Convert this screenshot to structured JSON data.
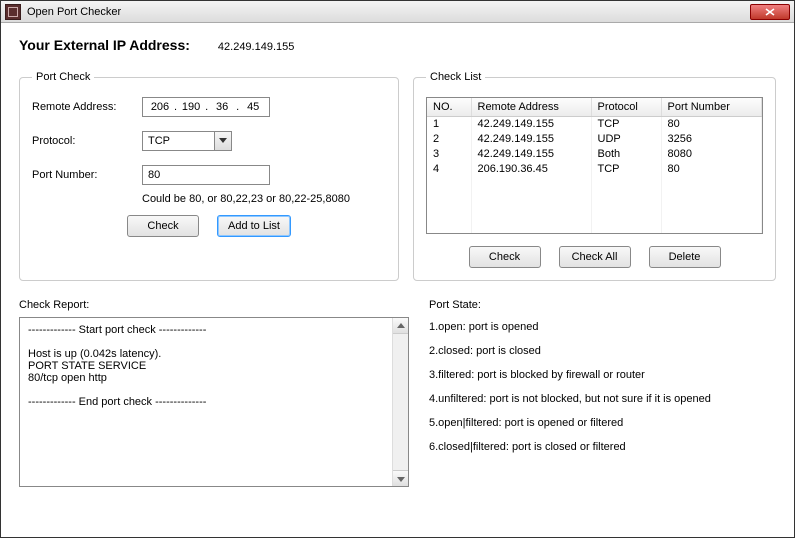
{
  "window": {
    "title": "Open Port Checker"
  },
  "header": {
    "ip_label": "Your External IP Address:",
    "ip_value": "42.249.149.155"
  },
  "portcheck": {
    "legend": "Port Check",
    "remote_addr_label": "Remote Address:",
    "remote_addr": {
      "a": "206",
      "b": "190",
      "c": "36",
      "d": "45"
    },
    "protocol_label": "Protocol:",
    "protocol_value": "TCP",
    "port_label": "Port Number:",
    "port_value": "80",
    "hint": "Could be 80, or 80,22,23 or 80,22-25,8080",
    "check_btn": "Check",
    "add_btn": "Add to List"
  },
  "checklist": {
    "legend": "Check List",
    "headers": {
      "no": "NO.",
      "addr": "Remote Address",
      "proto": "Protocol",
      "port": "Port Number"
    },
    "rows": [
      {
        "no": "1",
        "addr": "42.249.149.155",
        "proto": "TCP",
        "port": "80"
      },
      {
        "no": "2",
        "addr": "42.249.149.155",
        "proto": "UDP",
        "port": "3256"
      },
      {
        "no": "3",
        "addr": "42.249.149.155",
        "proto": "Both",
        "port": "8080"
      },
      {
        "no": "4",
        "addr": "206.190.36.45",
        "proto": "TCP",
        "port": "80"
      }
    ],
    "check_btn": "Check",
    "checkall_btn": "Check All",
    "delete_btn": "Delete"
  },
  "report": {
    "label": "Check Report:",
    "text": "------------- Start port check -------------\n\nHost is up (0.042s latency).\nPORT   STATE SERVICE\n80/tcp open  http\n\n------------- End port check --------------"
  },
  "states": {
    "title": "Port State:",
    "items": [
      "1.open: port is opened",
      "2.closed: port is closed",
      "3.filtered: port is blocked by firewall or router",
      "4.unfiltered: port is not blocked, but not sure if it is opened",
      "5.open|filtered: port is opened or filtered",
      "6.closed|filtered: port is closed or filtered"
    ]
  }
}
